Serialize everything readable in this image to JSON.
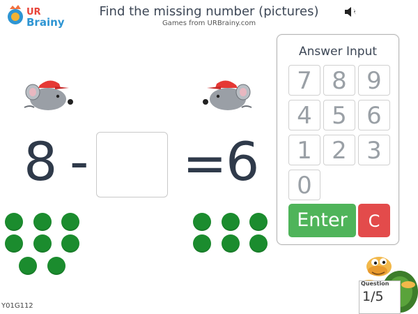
{
  "header": {
    "logo_text": "URBrainy",
    "title": "Find the missing number (pictures)",
    "subtitle": "Games from URBrainy.com",
    "sound_icon": "speaker-mute-icon"
  },
  "equation": {
    "left": "8",
    "operator": "-",
    "answer_value": "",
    "equals": "=",
    "right": "6"
  },
  "keypad": {
    "title": "Answer Input",
    "keys": [
      "7",
      "8",
      "9",
      "4",
      "5",
      "6",
      "1",
      "2",
      "3",
      "0"
    ],
    "enter_label": "Enter",
    "clear_label": "C"
  },
  "counters": {
    "left_count": 8,
    "right_count": 6,
    "color": "#1b8c2e"
  },
  "footer": {
    "code": "Y01G112",
    "question_label": "Question",
    "question_value": "1/5"
  },
  "colors": {
    "enter": "#4fb45a",
    "clear": "#e34b4b",
    "equation_text": "#2f3a4a"
  }
}
